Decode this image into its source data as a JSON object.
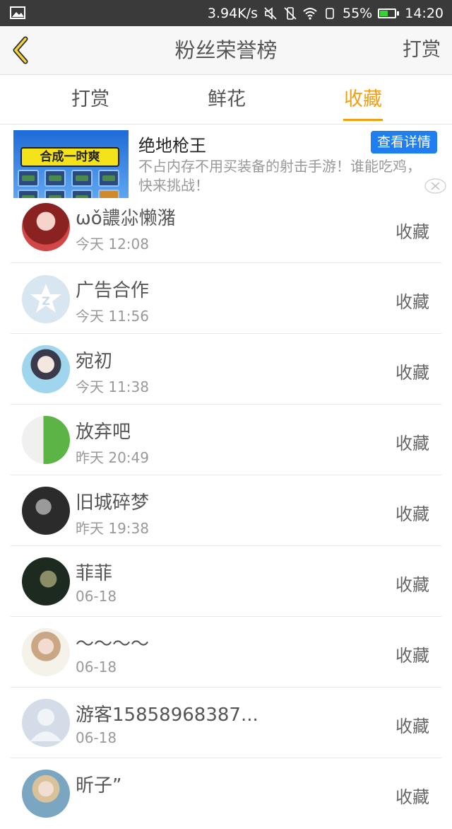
{
  "status_bar": {
    "speed": "3.94K/s",
    "battery": "55%",
    "time": "14:20",
    "battery_level": 0.55,
    "icons": [
      "image-icon",
      "mute-icon",
      "vibrate-icon",
      "wifi-icon",
      "sim-icon",
      "battery-icon"
    ]
  },
  "navbar": {
    "title": "粉丝荣誉榜",
    "right_action": "打赏"
  },
  "tabs": [
    {
      "label": "打赏",
      "active": false
    },
    {
      "label": "鲜花",
      "active": false
    },
    {
      "label": "收藏",
      "active": true
    }
  ],
  "ad": {
    "name": "绝地枪王",
    "description": "不占内存不用买装备的射击手游！谁能吃鸡，快来挑战！",
    "detail_button": "查看详情",
    "thumb_caption": "合成一时爽"
  },
  "list": [
    {
      "name": "ωǒ譨尛懒潴",
      "time": "今天 12:08",
      "action": "收藏"
    },
    {
      "name": "广告合作",
      "time": "今天 11:56",
      "action": "收藏"
    },
    {
      "name": "宛初",
      "time": "今天 11:38",
      "action": "收藏"
    },
    {
      "name": "放弃吧",
      "time": "昨天 20:49",
      "action": "收藏"
    },
    {
      "name": "旧城碎梦",
      "time": "昨天 19:38",
      "action": "收藏"
    },
    {
      "name": "菲菲",
      "time": "06-18",
      "action": "收藏"
    },
    {
      "name": "～～～～",
      "time": "06-18",
      "action": "收藏"
    },
    {
      "name": "游客15858968387...",
      "time": "06-18",
      "action": "收藏"
    },
    {
      "name": "昕子”",
      "time": "",
      "action": "收藏"
    }
  ],
  "colors": {
    "accent": "#f2a014",
    "status_bar": "#3a3a3a",
    "ad_button": "#1f7ff0"
  }
}
